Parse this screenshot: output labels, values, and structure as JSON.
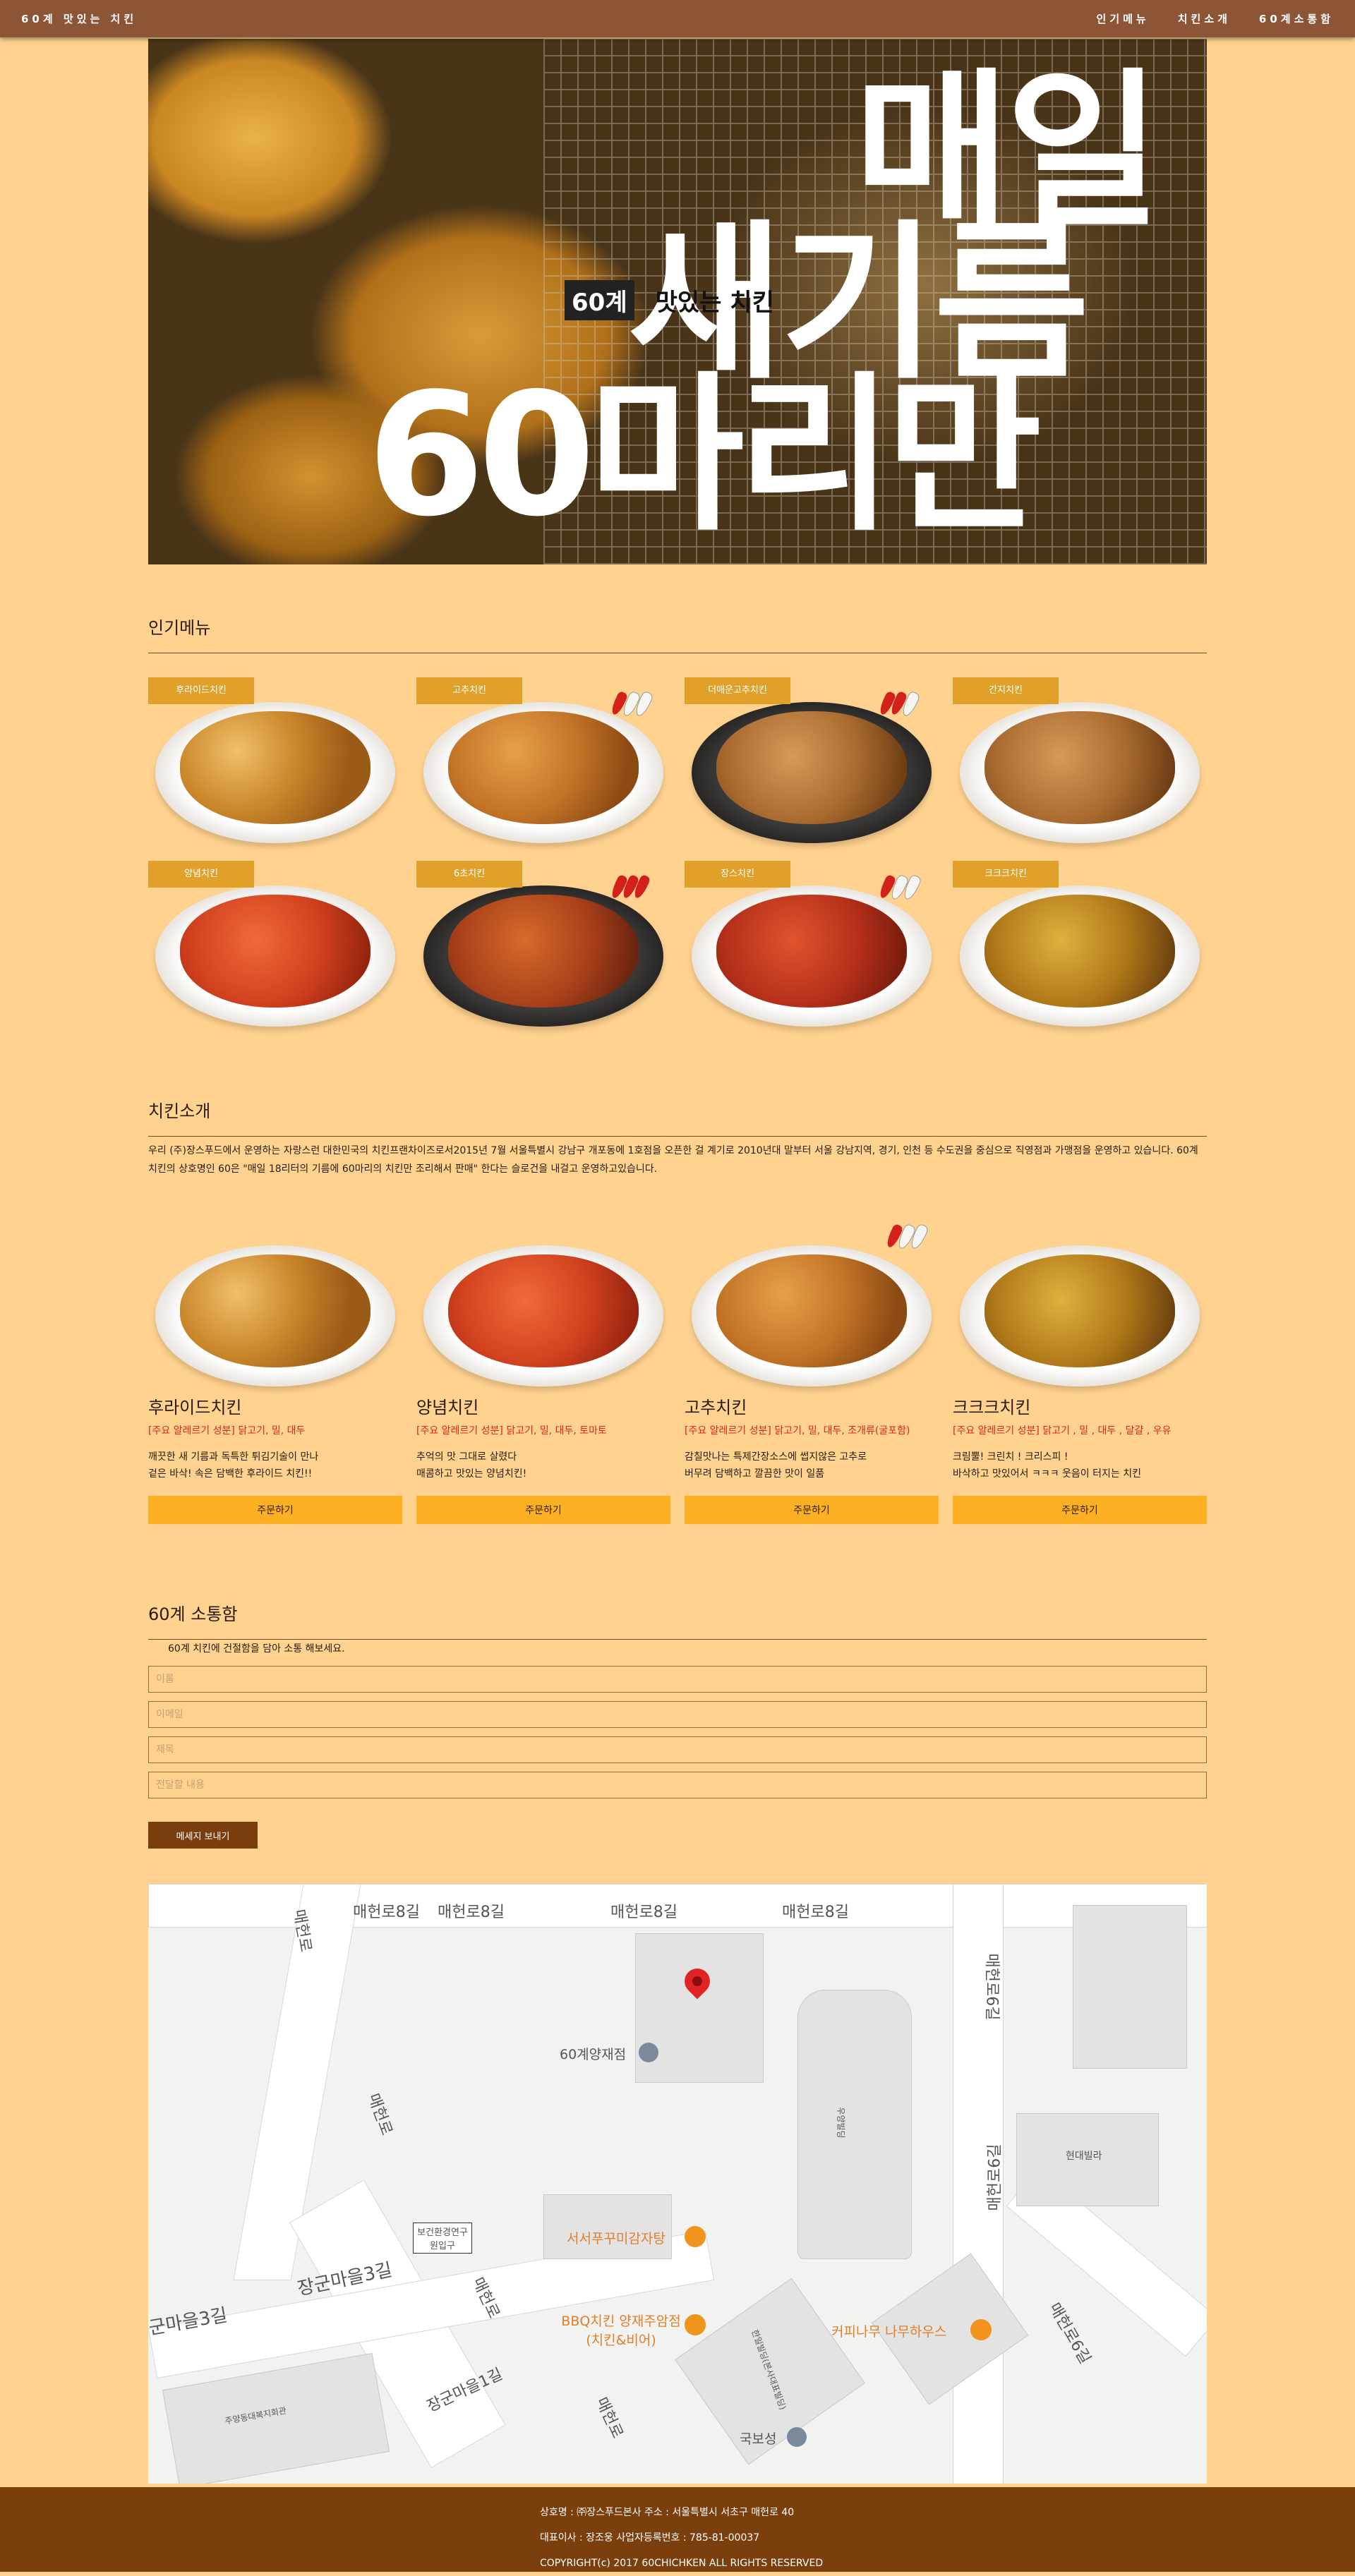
{
  "nav": {
    "brand": "60계 맛있는 치킨",
    "links": [
      "인기메뉴",
      "치킨소개",
      "60계소통함"
    ]
  },
  "hero": {
    "line1": "매일",
    "line2": "새기름",
    "line3": "60마리만",
    "badge": "60계",
    "tagline": "맛있는 치킨"
  },
  "popular": {
    "title": "인기메뉴",
    "items": [
      {
        "label": "후라이드치킨",
        "peppers": [],
        "style": "fried",
        "plate": "white"
      },
      {
        "label": "고추치킨",
        "peppers": [
          "r",
          "w",
          "w"
        ],
        "style": "pepper",
        "plate": "white"
      },
      {
        "label": "더매운고추치킨",
        "peppers": [
          "r",
          "r",
          "w"
        ],
        "style": "soy",
        "plate": "dark"
      },
      {
        "label": "간지치킨",
        "peppers": [],
        "style": "soy",
        "plate": "white"
      },
      {
        "label": "양념치킨",
        "peppers": [],
        "style": "sauced",
        "plate": "white"
      },
      {
        "label": "6초치킨",
        "peppers": [
          "r",
          "r",
          "r"
        ],
        "style": "spicy",
        "plate": "dark"
      },
      {
        "label": "장스치킨",
        "peppers": [
          "r",
          "w",
          "w"
        ],
        "style": "red",
        "plate": "white"
      },
      {
        "label": "크크크치킨",
        "peppers": [],
        "style": "crunch",
        "plate": "white"
      }
    ]
  },
  "intro": {
    "title": "치킨소개",
    "text": "우리 (주)장스푸드에서 운영하는 자랑스런 대한민국의 치킨프랜차이즈로서2015년 7월 서울특별시 강남구 개포동에 1호점을 오픈한 걸 계기로 2010년대 말부터 서울 강남지역, 경기, 인천 등 수도권을 중심으로 직영점과 가맹점을 운영하고 있습니다. 60계 치킨의 상호명인 60은 \"매일 18리터의 기름에 60마리의 치킨만 조리해서 판매\" 한다는 슬로건을 내걸고 운영하고있습니다.",
    "cards": [
      {
        "name": "후라이드치킨",
        "allergy": "[주요 알레르기 성분] 닭고기, 밀, 대두",
        "desc1": "깨끗한 새 기름과 독특한 튀김기술이 만나",
        "desc2": "겉은 바삭! 속은 담백한 후라이드 치킨!!",
        "order": "주문하기",
        "style": "fried",
        "peppers": []
      },
      {
        "name": "양념치킨",
        "allergy": "[주요 알레르기 성분] 닭고기, 밀, 대두, 토마토",
        "desc1": "추억의 맛 그대로 살렸다",
        "desc2": "매콤하고 맛있는 양념치킨!",
        "order": "주문하기",
        "style": "sauced",
        "peppers": []
      },
      {
        "name": "고추치킨",
        "allergy": "[주요 알레르기 성분] 닭고기, 밀, 대두, 조개류(굴포함)",
        "desc1": "감칠맛나는 특제간장소스에 썹지않은 고추로",
        "desc2": "버무려 담백하고 깔끔한 맛이 일품",
        "order": "주문하기",
        "style": "pepper",
        "peppers": [
          "r",
          "w",
          "w"
        ]
      },
      {
        "name": "크크크치킨",
        "allergy": "[주요 알레르기 성분] 닭고기 , 밀 , 대두 , 달걀 , 우유",
        "desc1": "크림뿔! 크린치 ! 크리스피 !",
        "desc2": "바삭하고 맛있어서 ㅋㅋㅋ 웃음이 터지는 치킨",
        "order": "주문하기",
        "style": "crunch",
        "peppers": []
      }
    ]
  },
  "contact": {
    "title": "60계 소통함",
    "subtitle": "60계 치킨에 건절함을 담아 소통 해보세요.",
    "fields": [
      "이름",
      "이메일",
      "제목",
      "전달할 내용"
    ],
    "send": "메세지 보내기"
  },
  "map": {
    "labels": [
      "매헌로8길",
      "매헌로8길",
      "매헌로8길",
      "매헌로8길",
      "매헌로",
      "매헌로",
      "매헌로",
      "매헌로",
      "장군마을3길",
      "장군마을1길",
      "군마을3길",
      "매헌로6길",
      "매헌로6길",
      "매헌로6길"
    ],
    "pois": [
      "60계양재점",
      "서서푸꾸미감자탕",
      "BBQ치킨 양재주암점 (치킨&비어)",
      "커피나무 나무하우스",
      "국보성"
    ],
    "buildings": [
      "현대빌라",
      "보건환경연구원입구",
      "주양동대복지회관",
      "우양빌딩",
      "한일빌딩(본사대표빌딩)"
    ]
  },
  "footer": {
    "line1": "상호명 : ㈜장스푸드본사 주소 : 서울특별시 서초구 매헌로 40",
    "line2": "대표이사 : 장조웅 사업자등록번호 : 785-81-00037",
    "line3": "COPYRIGHT(c) 2017 60CHICHKEN ALL RIGHTS RESERVED"
  },
  "colors": {
    "background": "#FFD28F",
    "nav": "#8B5536",
    "label": "#E0A02A",
    "order_button": "#FDB022",
    "send_button": "#7A3E0E",
    "footer": "#7B3F0E",
    "allergy": "#E0241A"
  }
}
